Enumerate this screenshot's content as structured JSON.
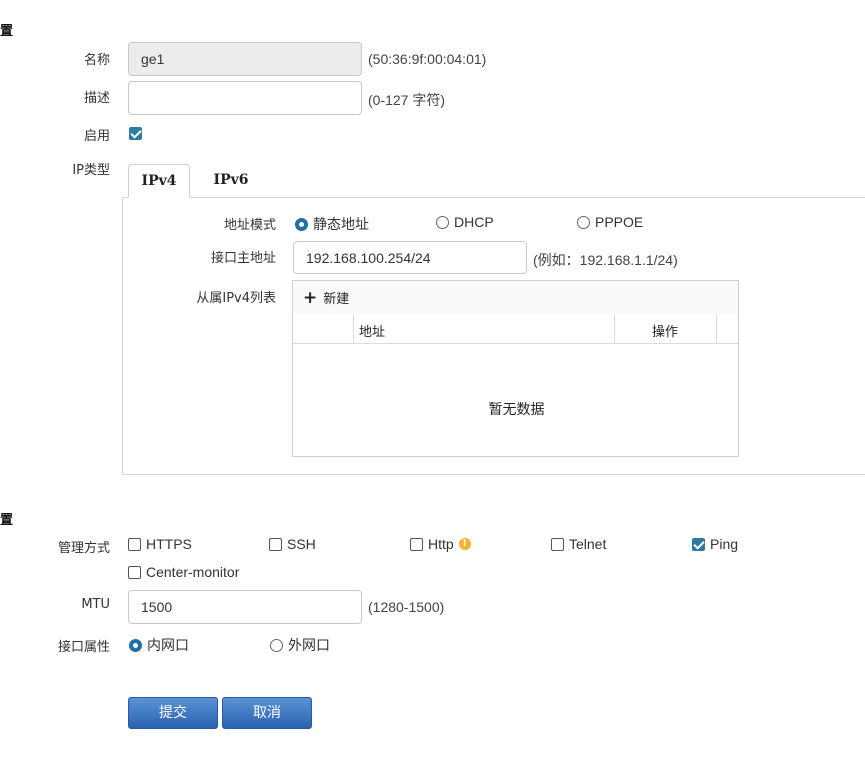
{
  "section1": {
    "title": "置"
  },
  "name": {
    "label": "名称",
    "value": "ge1",
    "hint": "(50:36:9f:00:04:01)"
  },
  "description": {
    "label": "描述",
    "value": "",
    "hint": "(0-127 字符)"
  },
  "enabled": {
    "label": "启用",
    "checked": true
  },
  "ip_type": {
    "label": "IP类型",
    "tabs": [
      {
        "label": "IPv4",
        "active": true
      },
      {
        "label": "IPv6",
        "active": false
      }
    ]
  },
  "ipv4": {
    "address_mode": {
      "label": "地址模式",
      "options": [
        {
          "label": "静态地址",
          "selected": true
        },
        {
          "label": "DHCP",
          "selected": false
        },
        {
          "label": "PPPOE",
          "selected": false
        }
      ]
    },
    "primary_address": {
      "label": "接口主地址",
      "value": "192.168.100.254/24",
      "hint": "(例如：192.168.1.1/24)"
    },
    "secondary_list": {
      "label": "从属IPv4列表",
      "new_label": "新建",
      "columns": [
        "地址",
        "操作"
      ],
      "empty_text": "暂无数据"
    }
  },
  "section2": {
    "title": "置"
  },
  "management": {
    "label": "管理方式",
    "options": [
      {
        "label": "HTTPS",
        "checked": false
      },
      {
        "label": "SSH",
        "checked": false
      },
      {
        "label": "Http",
        "checked": false
      },
      {
        "label": "Telnet",
        "checked": false
      },
      {
        "label": "Ping",
        "checked": true
      },
      {
        "label": "Center-monitor",
        "checked": false
      }
    ],
    "warn_icon": "warning-icon",
    "warn_color": "#f0b429"
  },
  "mtu": {
    "label": "MTU",
    "value": "1500",
    "hint": "(1280-1500)"
  },
  "interface_attr": {
    "label": "接口属性",
    "options": [
      {
        "label": "内网口",
        "selected": true
      },
      {
        "label": "外网口",
        "selected": false
      }
    ]
  },
  "buttons": {
    "submit": "提交",
    "cancel": "取消"
  },
  "colors": {
    "primary_button": "#2a61b0",
    "checkbox": "#2f7ba3",
    "radio": "#1f6fa8"
  }
}
